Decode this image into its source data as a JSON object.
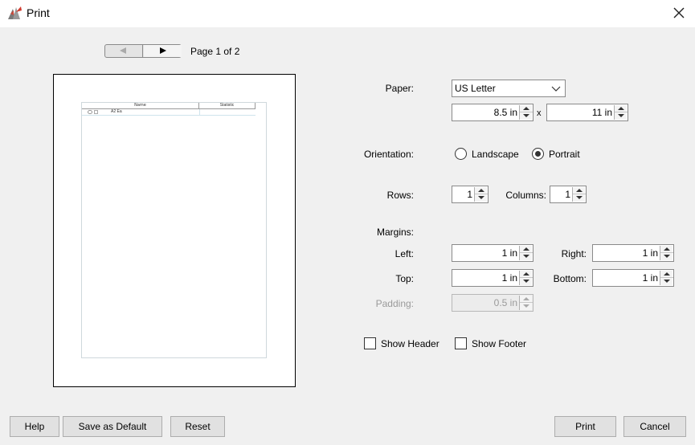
{
  "window": {
    "title": "Print"
  },
  "pager": {
    "page_label": "Page 1 of 2"
  },
  "preview": {
    "columns": [
      "Name",
      "Statistic"
    ],
    "rows": [
      [
        "A2 Ea",
        ""
      ]
    ]
  },
  "form": {
    "paper_label": "Paper:",
    "paper_value": "US Letter",
    "width_value": "8.5 in",
    "times": "x",
    "height_value": "11 in",
    "orientation_label": "Orientation:",
    "landscape_label": "Landscape",
    "portrait_label": "Portrait",
    "orientation_selected": "Portrait",
    "rows_label": "Rows:",
    "rows_value": "1",
    "columns_label": "Columns:",
    "columns_value": "1",
    "margins_label": "Margins:",
    "left_label": "Left:",
    "left_value": "1 in",
    "right_label": "Right:",
    "right_value": "1 in",
    "top_label": "Top:",
    "top_value": "1 in",
    "bottom_label": "Bottom:",
    "bottom_value": "1 in",
    "padding_label": "Padding:",
    "padding_value": "0.5 in",
    "show_header_label": "Show Header",
    "show_header_checked": false,
    "show_footer_label": "Show Footer",
    "show_footer_checked": false
  },
  "buttons": {
    "help": "Help",
    "save_default": "Save as Default",
    "reset": "Reset",
    "print": "Print",
    "cancel": "Cancel"
  }
}
